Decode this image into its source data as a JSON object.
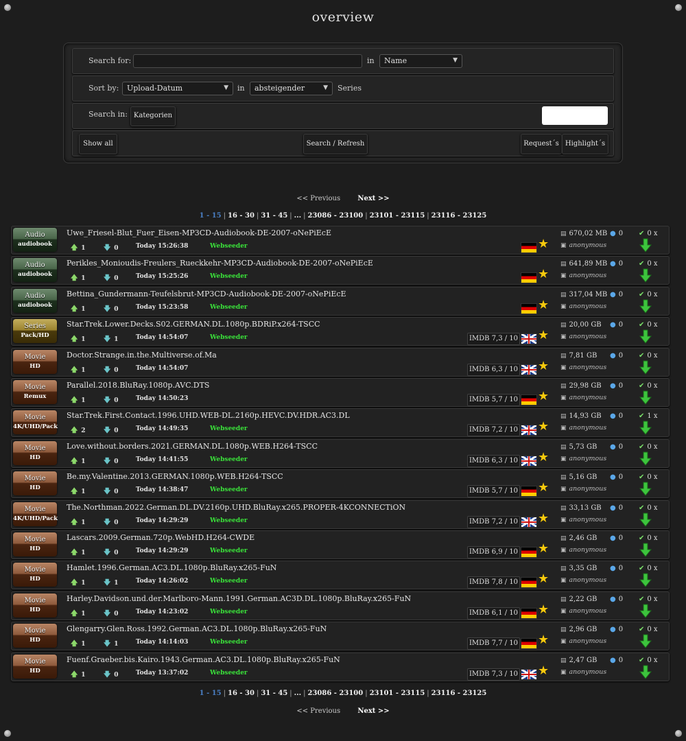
{
  "page": {
    "title": "overview"
  },
  "search": {
    "label_for": "Search for:",
    "query_value": "",
    "in_label": "in",
    "field_selected": "Name",
    "label_sort": "Sort by:",
    "sort_selected": "Upload-Datum",
    "sort_in_label": "in",
    "order_selected": "absteigender",
    "order_suffix": "Series",
    "label_search_in": "Search in:",
    "categories_button": "Kategorien",
    "show_all_button": "Show all",
    "search_button": "Search / Refresh",
    "requests_button": "Request´s",
    "highlights_button": "Highlight´s"
  },
  "pager": {
    "previous": "<< Previous",
    "next": "Next >>",
    "pages": [
      "1 - 15",
      "16 - 30",
      "31 - 45",
      "...",
      "23086 - 23100",
      "23101 - 23115",
      "23116 - 23125"
    ],
    "current_index": 0
  },
  "colors": {
    "seeder": "#3ae23a",
    "current_page": "#4a7fc4",
    "star": "#f6c90e"
  },
  "torrents": [
    {
      "cat": "Audio",
      "sub": "audiobook",
      "style": "audio",
      "name": "Uwe_Friesel-Blut_Fuer_Eisen-MP3CD-Audiobook-DE-2007-oNePiEcE",
      "up": "1",
      "down": "0",
      "date": "Today 15:26:38",
      "seeder": "Webseeder",
      "imdb": "",
      "flag": "de",
      "size": "670,02 MB",
      "user": "anonymous",
      "comments": "0",
      "snatched": "0 x"
    },
    {
      "cat": "Audio",
      "sub": "audiobook",
      "style": "audio",
      "name": "Perikles_Monioudis-Freulers_Rueckkehr-MP3CD-Audiobook-DE-2007-oNePiEcE",
      "up": "1",
      "down": "0",
      "date": "Today 15:25:26",
      "seeder": "Webseeder",
      "imdb": "",
      "flag": "de",
      "size": "641,89 MB",
      "user": "anonymous",
      "comments": "0",
      "snatched": "0 x"
    },
    {
      "cat": "Audio",
      "sub": "audiobook",
      "style": "audio",
      "name": "Bettina_Gundermann-Teufelsbrut-MP3CD-Audiobook-DE-2007-oNePiEcE",
      "up": "1",
      "down": "0",
      "date": "Today 15:23:58",
      "seeder": "Webseeder",
      "imdb": "",
      "flag": "de",
      "size": "317,04 MB",
      "user": "anonymous",
      "comments": "0",
      "snatched": "0 x"
    },
    {
      "cat": "Series",
      "sub": "Pack/HD",
      "style": "series",
      "name": "Star.Trek.Lower.Decks.S02.GERMAN.DL.1080p.BDRiP.x264-TSCC",
      "up": "1",
      "down": "1",
      "date": "Today 14:54:07",
      "seeder": "Webseeder",
      "imdb": "IMDB 7,3 / 10",
      "flag": "gb",
      "size": "20,00 GB",
      "user": "anonymous",
      "comments": "0",
      "snatched": "0 x"
    },
    {
      "cat": "Movie",
      "sub": "HD",
      "style": "movie",
      "name": "Doctor.Strange.in.the.Multiverse.of.Ma",
      "up": "1",
      "down": "0",
      "date": "Today 14:54:07",
      "seeder": "",
      "imdb": "IMDB 6,3 / 10",
      "flag": "gb",
      "size": "7,81 GB",
      "user": "anonymous",
      "comments": "0",
      "snatched": "0 x"
    },
    {
      "cat": "Movie",
      "sub": "Remux",
      "style": "movie",
      "name": "Parallel.2018.BluRay.1080p.AVC.DTS",
      "up": "1",
      "down": "0",
      "date": "Today 14:50:23",
      "seeder": "",
      "imdb": "IMDB 5,7 / 10",
      "flag": "de",
      "size": "29,98 GB",
      "user": "anonymous",
      "comments": "0",
      "snatched": "0 x"
    },
    {
      "cat": "Movie",
      "sub": "4K/UHD/Pack",
      "style": "movie",
      "name": "Star.Trek.First.Contact.1996.UHD.WEB-DL.2160p.HEVC.DV.HDR.AC3.DL",
      "up": "2",
      "down": "0",
      "date": "Today 14:49:35",
      "seeder": "Webseeder",
      "imdb": "IMDB 7,2 / 10",
      "flag": "gb",
      "size": "14,93 GB",
      "user": "anonymous",
      "comments": "0",
      "snatched": "1 x"
    },
    {
      "cat": "Movie",
      "sub": "HD",
      "style": "movie",
      "name": "Love.without.borders.2021.GERMAN.DL.1080p.WEB.H264-TSCC",
      "up": "1",
      "down": "0",
      "date": "Today 14:41:55",
      "seeder": "Webseeder",
      "imdb": "IMDB 6,3 / 10",
      "flag": "gb",
      "size": "5,73 GB",
      "user": "anonymous",
      "comments": "0",
      "snatched": "0 x"
    },
    {
      "cat": "Movie",
      "sub": "HD",
      "style": "movie",
      "name": "Be.my.Valentine.2013.GERMAN.1080p.WEB.H264-TSCC",
      "up": "1",
      "down": "0",
      "date": "Today 14:38:47",
      "seeder": "Webseeder",
      "imdb": "IMDB 5,7 / 10",
      "flag": "de",
      "size": "5,16 GB",
      "user": "anonymous",
      "comments": "0",
      "snatched": "0 x"
    },
    {
      "cat": "Movie",
      "sub": "4K/UHD/Pack",
      "style": "movie",
      "name": "The.Northman.2022.German.DL.DV.2160p.UHD.BluRay.x265.PROPER-4KCONNECTiON",
      "up": "1",
      "down": "0",
      "date": "Today 14:29:29",
      "seeder": "Webseeder",
      "imdb": "IMDB 7,2 / 10",
      "flag": "gb",
      "size": "33,13 GB",
      "user": "anonymous",
      "comments": "0",
      "snatched": "0 x"
    },
    {
      "cat": "Movie",
      "sub": "HD",
      "style": "movie",
      "name": "Lascars.2009.German.720p.WebHD.H264-CWDE",
      "up": "1",
      "down": "0",
      "date": "Today 14:29:29",
      "seeder": "Webseeder",
      "imdb": "IMDB 6,9 / 10",
      "flag": "de",
      "size": "2,46 GB",
      "user": "anonymous",
      "comments": "0",
      "snatched": "0 x"
    },
    {
      "cat": "Movie",
      "sub": "HD",
      "style": "movie",
      "name": "Hamlet.1996.German.AC3.DL.1080p.BluRay.x265-FuN",
      "up": "1",
      "down": "1",
      "date": "Today 14:26:02",
      "seeder": "Webseeder",
      "imdb": "IMDB 7,8 / 10",
      "flag": "de",
      "size": "3,35 GB",
      "user": "anonymous",
      "comments": "0",
      "snatched": "0 x"
    },
    {
      "cat": "Movie",
      "sub": "HD",
      "style": "movie",
      "name": "Harley.Davidson.und.der.Marlboro-Mann.1991.German.AC3D.DL.1080p.BluRay.x265-FuN",
      "up": "1",
      "down": "0",
      "date": "Today 14:23:02",
      "seeder": "Webseeder",
      "imdb": "IMDB 6,1 / 10",
      "flag": "de",
      "size": "2,22 GB",
      "user": "anonymous",
      "comments": "0",
      "snatched": "0 x"
    },
    {
      "cat": "Movie",
      "sub": "HD",
      "style": "movie",
      "name": "Glengarry.Glen.Ross.1992.German.AC3.DL.1080p.BluRay.x265-FuN",
      "up": "1",
      "down": "1",
      "date": "Today 14:14:03",
      "seeder": "Webseeder",
      "imdb": "IMDB 7,7 / 10",
      "flag": "de",
      "size": "2,96 GB",
      "user": "anonymous",
      "comments": "0",
      "snatched": "0 x"
    },
    {
      "cat": "Movie",
      "sub": "HD",
      "style": "movie",
      "name": "Fuenf.Graeber.bis.Kairo.1943.German.AC3.DL.1080p.BluRay.x265-FuN",
      "up": "1",
      "down": "0",
      "date": "Today 13:37:02",
      "seeder": "Webseeder",
      "imdb": "IMDB 7,3 / 10",
      "flag": "gb",
      "size": "2,47 GB",
      "user": "anonymous",
      "comments": "0",
      "snatched": "0 x"
    }
  ]
}
